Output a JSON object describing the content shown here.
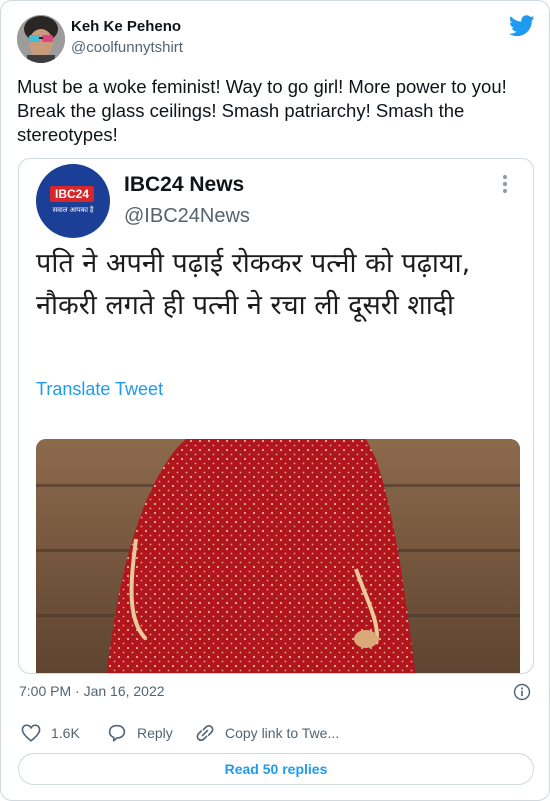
{
  "author": {
    "name": "Keh Ke Peheno",
    "handle": "@coolfunnytshirt"
  },
  "tweet_text": "Must be a woke feminist! Way to go girl! More power to you! Break the glass ceilings! Smash patriarchy! Smash the stereotypes!",
  "quoted_tweet": {
    "logo_text": "IBC24",
    "logo_tagline": "सवाल आपका है",
    "name": "IBC24 News",
    "handle": "@IBC24News",
    "text": "पति ने अपनी पढ़ाई रोककर पत्नी को पढ़ाया, नौकरी लगते ही पत्नी ने रचा ली दूसरी शादी",
    "translate_label": "Translate Tweet"
  },
  "timestamp": "7:00 PM · Jan 16, 2022",
  "actions": {
    "likes_count": "1.6K",
    "reply_label": "Reply",
    "copy_label": "Copy link to Twe..."
  },
  "read_replies_label": "Read 50 replies",
  "colors": {
    "accent": "#1d9bf0",
    "text_primary": "#0f1419",
    "text_secondary": "#536471",
    "border": "#cfd9de",
    "logo_blue": "#1b3f96",
    "logo_red": "#d7272a"
  },
  "icons": [
    "twitter-bird-icon",
    "more-options-icon",
    "info-icon",
    "heart-icon",
    "reply-icon",
    "link-icon"
  ]
}
